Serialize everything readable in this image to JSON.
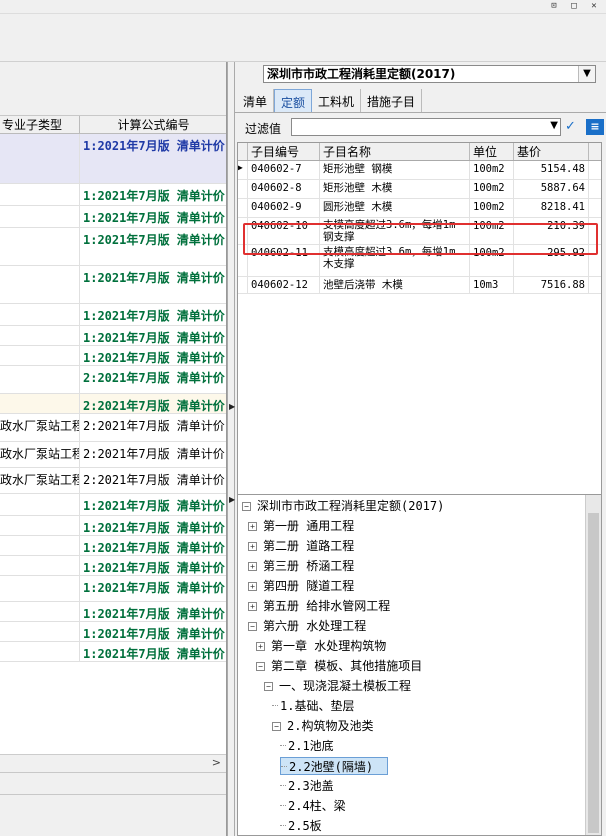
{
  "window": {
    "controls": [
      "⊡",
      "□",
      "✕"
    ]
  },
  "left": {
    "columns": [
      "专业子类型",
      "计算公式编号"
    ],
    "rows": [
      {
        "type": "",
        "formula": "1:2021年7月版 清单计价",
        "style": "blue"
      },
      {
        "type": "",
        "formula": "1:2021年7月版 清单计价",
        "style": "green"
      },
      {
        "type": "",
        "formula": "1:2021年7月版 清单计价",
        "style": "green"
      },
      {
        "type": "",
        "formula": "1:2021年7月版 清单计价",
        "style": "green"
      },
      {
        "type": "",
        "formula": "1:2021年7月版 清单计价",
        "style": "green"
      },
      {
        "type": "",
        "formula": "1:2021年7月版 清单计价",
        "style": "green"
      },
      {
        "type": "",
        "formula": "1:2021年7月版 清单计价",
        "style": "green"
      },
      {
        "type": "",
        "formula": "1:2021年7月版 清单计价",
        "style": "green"
      },
      {
        "type": "",
        "formula": "2:2021年7月版 清单计价",
        "style": "green"
      },
      {
        "type": "",
        "formula": "2:2021年7月版 清单计价",
        "style": "green"
      },
      {
        "type": "政水厂泵站工程",
        "formula": "2:2021年7月版 清单计价 i",
        "style": "plain"
      },
      {
        "type": "政水厂泵站工程",
        "formula": "2:2021年7月版 清单计价 i",
        "style": "plain"
      },
      {
        "type": "政水厂泵站工程",
        "formula": "2:2021年7月版 清单计价 i",
        "style": "plain"
      },
      {
        "type": "",
        "formula": "1:2021年7月版 清单计价",
        "style": "green"
      },
      {
        "type": "",
        "formula": "1:2021年7月版 清单计价",
        "style": "green"
      },
      {
        "type": "",
        "formula": "1:2021年7月版 清单计价",
        "style": "green"
      },
      {
        "type": "",
        "formula": "1:2021年7月版 清单计价",
        "style": "green"
      },
      {
        "type": "",
        "formula": "1:2021年7月版 清单计价",
        "style": "green"
      },
      {
        "type": "",
        "formula": "1:2021年7月版 清单计价",
        "style": "green"
      },
      {
        "type": "",
        "formula": "1:2021年7月版 清单计价",
        "style": "green"
      },
      {
        "type": "",
        "formula": "1:2021年7月版 清单计价",
        "style": "green"
      }
    ],
    "scroll_arrow": ">"
  },
  "right": {
    "quota_db": "深圳市市政工程消耗里定额(2017)",
    "tabs": [
      "清单",
      "定额",
      "工料机",
      "措施子目"
    ],
    "active_tab": "定额",
    "filter_label": "过滤值",
    "filter_value": "",
    "grid": {
      "columns": [
        "子目编号",
        "子目名称",
        "单位",
        "基价"
      ],
      "rows": [
        {
          "code": "040602-7",
          "name": "矩形池壁 钢模",
          "unit": "100m2",
          "price": "5154.48",
          "marker": "▶"
        },
        {
          "code": "040602-8",
          "name": "矩形池壁 木模",
          "unit": "100m2",
          "price": "5887.64",
          "marker": ""
        },
        {
          "code": "040602-9",
          "name": "圆形池壁 木模",
          "unit": "100m2",
          "price": "8218.41",
          "marker": ""
        },
        {
          "code": "040602-10",
          "name": "支模高度超过3.6m，每增1m 钢支撑",
          "unit": "100m2",
          "price": "210.39",
          "marker": ""
        },
        {
          "code": "040602-11",
          "name": "支模高度超过3.6m，每增1m 木支撑",
          "unit": "100m2",
          "price": "295.92",
          "marker": ""
        },
        {
          "code": "040602-12",
          "name": "池壁后浇带 木模",
          "unit": "10m3",
          "price": "7516.88",
          "marker": ""
        }
      ]
    },
    "tree": [
      {
        "label": "深圳市市政工程消耗里定额(2017)",
        "toggle": "−",
        "level": 0
      },
      {
        "label": "第一册 通用工程",
        "toggle": "+",
        "level": 1
      },
      {
        "label": "第二册 道路工程",
        "toggle": "+",
        "level": 1
      },
      {
        "label": "第三册 桥涵工程",
        "toggle": "+",
        "level": 1
      },
      {
        "label": "第四册 隧道工程",
        "toggle": "+",
        "level": 1
      },
      {
        "label": "第五册 给排水管网工程",
        "toggle": "+",
        "level": 1
      },
      {
        "label": "第六册 水处理工程",
        "toggle": "−",
        "level": 1
      },
      {
        "label": "第一章 水处理构筑物",
        "toggle": "+",
        "level": 2
      },
      {
        "label": "第二章 模板、其他措施项目",
        "toggle": "−",
        "level": 2
      },
      {
        "label": "一、现浇混凝土模板工程",
        "toggle": "−",
        "level": 3
      },
      {
        "label": "1.基础、垫层",
        "toggle": "",
        "level": 4
      },
      {
        "label": "2.构筑物及池类",
        "toggle": "−",
        "level": 4
      },
      {
        "label": "2.1池底",
        "toggle": "",
        "level": 5
      },
      {
        "label": "2.2池壁(隔墙)",
        "toggle": "",
        "level": 5,
        "selected": true
      },
      {
        "label": "2.3池盖",
        "toggle": "",
        "level": 5
      },
      {
        "label": "2.4柱、梁",
        "toggle": "",
        "level": 5
      },
      {
        "label": "2.5板",
        "toggle": "",
        "level": 5
      }
    ]
  }
}
